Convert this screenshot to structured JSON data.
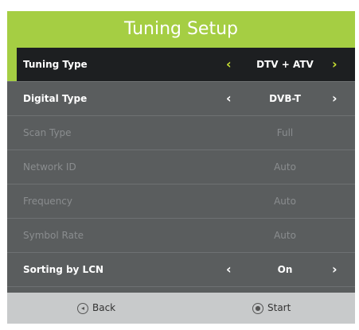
{
  "title": "Tuning Setup",
  "rows": [
    {
      "label": "Tuning Type",
      "value": "DTV + ATV",
      "state": "selected"
    },
    {
      "label": "Digital Type",
      "value": "DVB-T",
      "state": "enabled"
    },
    {
      "label": "Scan Type",
      "value": "Full",
      "state": "disabled"
    },
    {
      "label": "Network ID",
      "value": "Auto",
      "state": "disabled"
    },
    {
      "label": "Frequency",
      "value": "Auto",
      "state": "disabled"
    },
    {
      "label": "Symbol Rate",
      "value": "Auto",
      "state": "disabled"
    },
    {
      "label": "Sorting by LCN",
      "value": "On",
      "state": "enabled"
    }
  ],
  "footer": {
    "back_label": "Back",
    "start_label": "Start"
  },
  "colors": {
    "accent": "#a5ce43",
    "panel": "#5a5d5e",
    "selected_row": "#1d1f21"
  }
}
